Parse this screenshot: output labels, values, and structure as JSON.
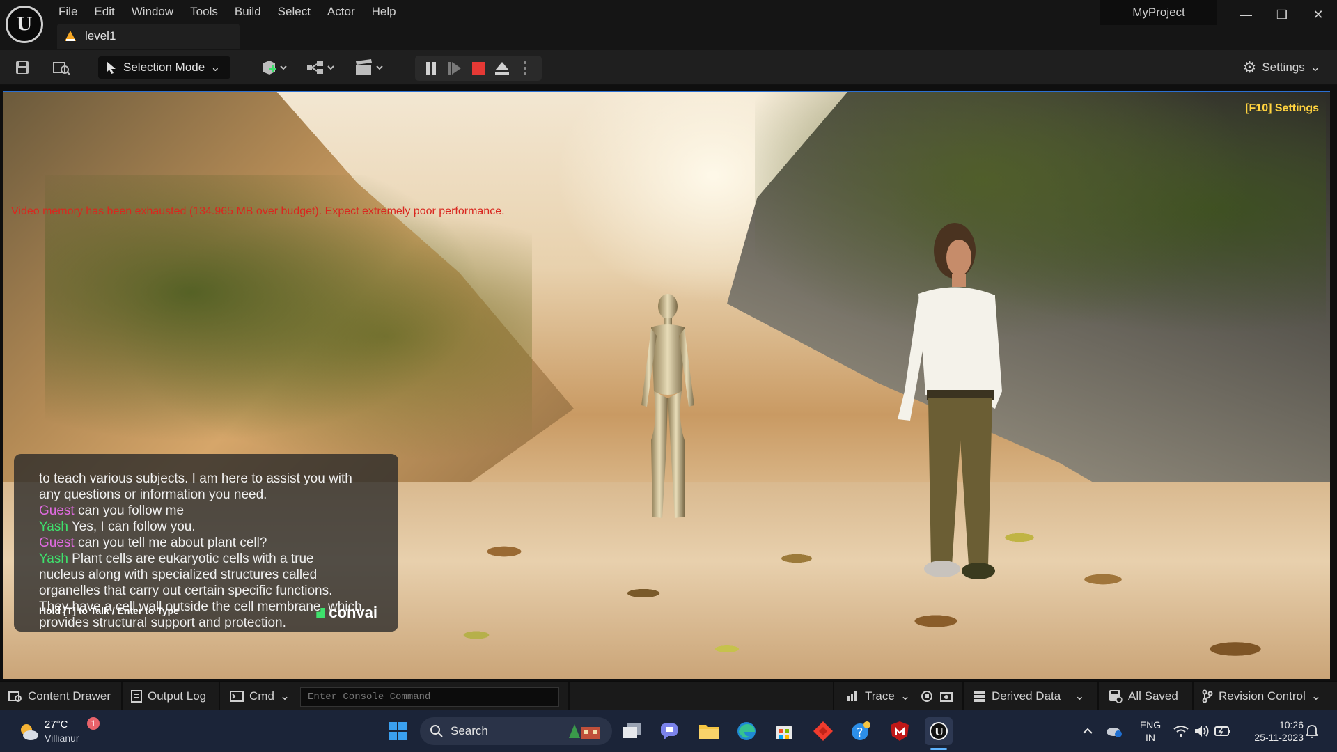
{
  "titlebar": {
    "menu": [
      "File",
      "Edit",
      "Window",
      "Tools",
      "Build",
      "Select",
      "Actor",
      "Help"
    ],
    "level_tab": "level1",
    "project": "MyProject"
  },
  "toolbar": {
    "selection_mode": "Selection Mode",
    "settings": "Settings"
  },
  "viewport": {
    "vram_warning": "Video memory has been exhausted (134.965 MB over budget). Expect extremely poor performance.",
    "f10_settings": "[F10] Settings",
    "chat": {
      "lines": [
        {
          "speaker": "",
          "text": "to teach various subjects.  I am here to assist you with"
        },
        {
          "speaker": "",
          "text": "any questions or information you need."
        },
        {
          "speaker": "Guest",
          "text": " can you follow me"
        },
        {
          "speaker": "Yash",
          "text": "  Yes, I can follow you."
        },
        {
          "speaker": "Guest",
          "text": " can you tell me about plant cell?"
        },
        {
          "speaker": "Yash",
          "text": "  Plant cells are eukaryotic cells with a true"
        },
        {
          "speaker": "",
          "text": "nucleus along with specialized structures called"
        },
        {
          "speaker": "",
          "text": "organelles that carry out certain specific functions."
        },
        {
          "speaker": "",
          "text": "They have a cell wall outside the cell membrane, which"
        },
        {
          "speaker": "",
          "text": "provides structural support and protection."
        }
      ],
      "hint": "Hold [T] to Talk / Enter to Type",
      "brand": "convai"
    }
  },
  "statusbar": {
    "content_drawer": "Content Drawer",
    "output_log": "Output Log",
    "cmd": "Cmd",
    "console_placeholder": "Enter Console Command",
    "trace": "Trace",
    "derived_data": "Derived Data",
    "all_saved": "All Saved",
    "revision_control": "Revision Control"
  },
  "taskbar": {
    "weather_temp": "27°C",
    "weather_location": "Villianur",
    "weather_badge": "1",
    "search": "Search",
    "lang_top": "ENG",
    "lang_bottom": "IN",
    "time": "10:26",
    "date": "25-11-2023"
  },
  "colors": {
    "accent_blue": "#2b6fd1",
    "warning_red": "#d9271f",
    "f10_yellow": "#ffd23f",
    "guest_name": "#e06be0",
    "yash_name": "#3ee06c",
    "stop_red": "#e53935"
  }
}
